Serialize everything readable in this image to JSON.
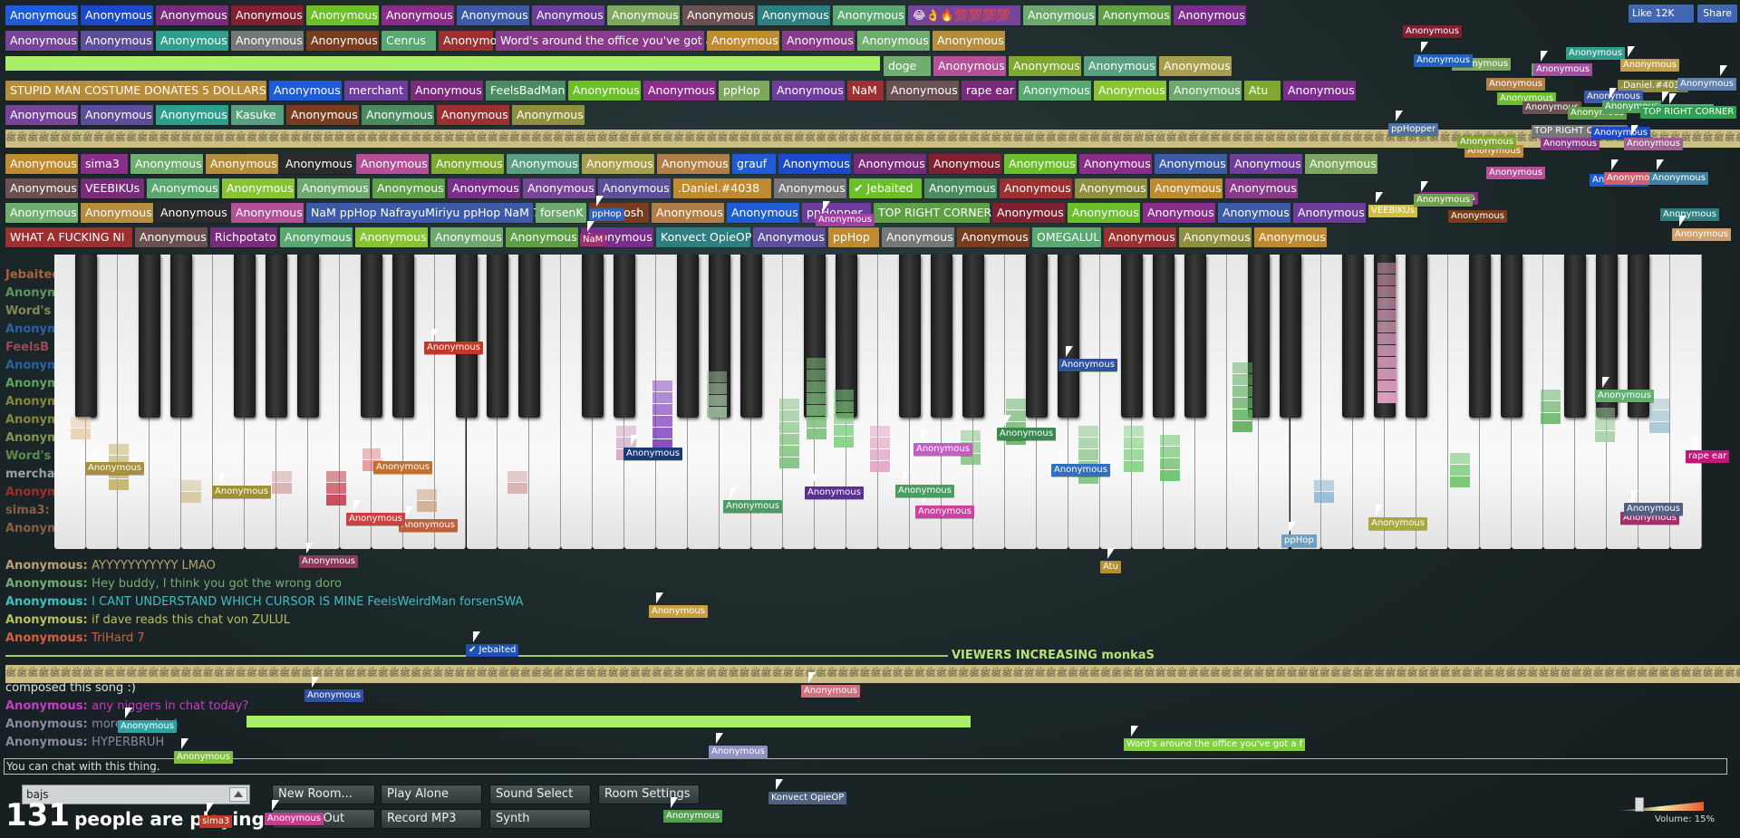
{
  "facebook": {
    "like": "Like 12K",
    "share": "Share"
  },
  "username_tags": [
    {
      "t": "Anonymous",
      "c": "#1f5bd6"
    },
    {
      "t": "Anonymous",
      "c": "#1a4acb"
    },
    {
      "t": "Anonymous",
      "c": "#7a2a7a"
    },
    {
      "t": "Anonymous",
      "c": "#802030"
    },
    {
      "t": "Anonymous",
      "c": "#6bbf2a"
    },
    {
      "t": "Anonymous",
      "c": "#8a2d8a"
    },
    {
      "t": "Anonymous",
      "c": "#3c5aa8"
    },
    {
      "t": "Anonymous",
      "c": "#6d3c9c"
    },
    {
      "t": "Anonymous",
      "c": "#7ea860"
    },
    {
      "t": "Anonymous",
      "c": "#6a5050"
    },
    {
      "t": "Anonymous",
      "c": "#2e7f7f"
    },
    {
      "t": "Anonymous",
      "c": "#58a870"
    },
    {
      "t": "Anonymous",
      "c": "#87c432"
    },
    {
      "t": "Anonymous",
      "c": "#6da86d"
    },
    {
      "t": "Anonymous",
      "c": "#5ea045"
    },
    {
      "t": "Anonymous",
      "c": "#7b2d8c"
    },
    {
      "t": "Anonymous",
      "c": "#76459a"
    },
    {
      "t": "Anonymous",
      "c": "#5c4e9b"
    },
    {
      "t": "Anonymous",
      "c": "#2f9f8c"
    },
    {
      "t": "Anonymous",
      "c": "#777777"
    },
    {
      "t": "Anonymous",
      "c": "#7a3c1e"
    },
    {
      "t": "Anonymous",
      "c": "#4a8c60"
    },
    {
      "t": "Anonymous",
      "c": "#9c2f2f"
    },
    {
      "t": "Anonymous",
      "c": "#8f8f40"
    },
    {
      "t": "Anonymous",
      "c": "#c08b30"
    },
    {
      "t": "Anonymous",
      "c": "#8a3a8a"
    },
    {
      "t": "Anonymous",
      "c": "#6fae6f"
    },
    {
      "t": "Anonymous",
      "c": "#b68d3c"
    },
    {
      "t": "Anonymous",
      "c": "#2b2b2b"
    },
    {
      "t": "Anonymous",
      "c": "#b44f98"
    },
    {
      "t": "Anonymous",
      "c": "#7ea830"
    },
    {
      "t": "Anonymous",
      "c": "#58a080"
    },
    {
      "t": "Anonymous",
      "c": "#a6a04e"
    },
    {
      "t": "Anonymous",
      "c": "#b37e46"
    }
  ],
  "row1_extra": [
    "Anonymous",
    "Anonymous",
    "Anonymous",
    "Anonymous",
    "Anonymous",
    "Anonymous",
    "Anonymous",
    "Anonymous",
    "Anonymous",
    "Anonymous",
    "Anonymous",
    "Anonymous",
    "Anonymous",
    "Anonymous"
  ],
  "named_tags": {
    "doge": "doge",
    "stupid": "STUPID MAN COSTUME DONATES 5 DOLLARS",
    "merchant": "merchant",
    "feelsbadman": "FeelsBadMan",
    "pphop": "ppHop",
    "nam": "NaM",
    "rape_ear": "rape ear",
    "atu": "Atu",
    "kasuke": "Kasuke",
    "sima3": "sima3",
    "grauf": "grauf",
    "veebikus": "VEEBIKUs",
    "daniel": ".Daniel.#4038",
    "jebaited": "✔ Jebaited",
    "nam_pphop": "NaM ppHop NafrayuMiriyu ppHop NaM 7",
    "forsenk": "forsenK",
    "teemosh": "Teemosh",
    "pphopper": "ppHopper",
    "top_right": "TOP RIGHT CORNER",
    "wtf": "WHAT A FUCKING NI",
    "richpotato": "Richpotato",
    "konvect": "Konvect OpieOP",
    "omegalul": "OMEGALUL",
    "words": "Word's around the office you've got a f",
    "cenrus": "Cenrus",
    "emotes": "😂👌🔥💯💯💯💯"
  },
  "chat": [
    {
      "name": "Anonymous:",
      "msg": "AYYYYYYYYYYY LMAO",
      "c": "#b8a070"
    },
    {
      "name": "Anonymous:",
      "msg": "Hey buddy, I think you got the wrong doro",
      "c": "#6fae6f"
    },
    {
      "name": "Anonymous:",
      "msg": "I CANT UNDERSTAND WHICH CURSOR IS MINE FeelsWeirdMan forsenSWA",
      "c": "#3fc0c0"
    },
    {
      "name": "Anonymous:",
      "msg": "if dave reads this chat von ZULUL",
      "c": "#b8c05a"
    },
    {
      "name": "Anonymous:",
      "msg": "TriHard 7",
      "c": "#d2603c"
    }
  ],
  "chat_lower": [
    {
      "name": "",
      "msg": "composed this song :)",
      "c": "#e0e0e0"
    },
    {
      "name": "Anonymous:",
      "msg": "any niggers in chat today?",
      "c": "#c040c0"
    },
    {
      "name": "Anonymous:",
      "msg": "more people :)",
      "c": "#8a8aa0"
    },
    {
      "name": "Anonymous:",
      "msg": "HYPERBRUH",
      "c": "#8a8aa0"
    }
  ],
  "viewers": "VIEWERS INCREASING monkaS",
  "chat_input": {
    "value": "You can chat with this thing."
  },
  "room": {
    "value": "bajs"
  },
  "buttons": {
    "new_room": "New Room...",
    "play_alone": "Play Alone",
    "sound_select": "Sound Select",
    "room_settings": "Room Settings",
    "midi": "MIDI In/Out",
    "record": "Record MP3",
    "synth": "Synth"
  },
  "players": {
    "count": "131",
    "text": "people are playing"
  },
  "volume": "Volume: 15%",
  "left_column": [
    "Jebaited",
    "Anonymous",
    "Word's",
    "Anonymous",
    "FeelsB",
    "Anonymous",
    "Anonymous",
    "Anonymous",
    "Anonymous",
    "Anonymous",
    "Word's",
    "merchant",
    "Anonymous",
    "sima3:",
    "Anonymous"
  ],
  "floating_names": [
    {
      "t": "Anonymous",
      "c": "#c0392b"
    },
    {
      "t": "Anonymous",
      "c": "#1a3a7a"
    },
    {
      "t": "Anonymous",
      "c": "#c07030"
    },
    {
      "t": "Anonymous",
      "c": "#a09030"
    },
    {
      "t": "Anonymous",
      "c": "#a8903c"
    },
    {
      "t": "Anonymous",
      "c": "#c0603a"
    },
    {
      "t": "Anonymous",
      "c": "#d04040"
    },
    {
      "t": "Anonymous",
      "c": "#8a3a5a"
    },
    {
      "t": "Anonymous",
      "c": "#3050a0"
    },
    {
      "t": "Anonymous",
      "c": "#4a9c60"
    },
    {
      "t": "Anonymous",
      "c": "#5a3090"
    },
    {
      "t": "Anonymous",
      "c": "#c060c0"
    },
    {
      "t": "Anonymous",
      "c": "#3a8a50"
    },
    {
      "t": "Anonymous",
      "c": "#d040a0"
    },
    {
      "t": "Anonymous",
      "c": "#4a9c60"
    },
    {
      "t": "Anonymous",
      "c": "#3070c0"
    },
    {
      "t": "Anonymous",
      "c": "#a8a840"
    },
    {
      "t": "Anonymous",
      "c": "#a03070"
    },
    {
      "t": "Anonymous",
      "c": "#506080"
    },
    {
      "t": "Atu",
      "c": "#b09030"
    },
    {
      "t": "Anonymous",
      "c": "#c8a040"
    },
    {
      "t": "✔ Jebaited",
      "c": "#2050b0"
    },
    {
      "t": "Anonymous",
      "c": "#3050a0"
    },
    {
      "t": "Anonymous",
      "c": "#d07080"
    },
    {
      "t": "Anonymous",
      "c": "#30a0a0"
    },
    {
      "t": "Anonymous",
      "c": "#9090c0"
    },
    {
      "t": "Anonymous",
      "c": "#80c040"
    },
    {
      "t": "Word's around the office you've got a f",
      "c": "#80d040"
    },
    {
      "t": "Konvect OpieOP",
      "c": "#506080"
    },
    {
      "t": "Anonymous",
      "c": "#50a050"
    },
    {
      "t": "Anonymous",
      "c": "#c04090"
    },
    {
      "t": "sima3",
      "c": "#c0392b"
    },
    {
      "t": "rape ear",
      "c": "#c0187a"
    },
    {
      "t": "ppHop",
      "c": "#70a0c0"
    },
    {
      "t": "Anonymous",
      "c": "#2060c0"
    },
    {
      "t": "Anonymous",
      "c": "#50a060"
    },
    {
      "t": "Anonymous",
      "c": "#50b080"
    },
    {
      "t": "TOP RIGHT CORNER",
      "c": "#30a050"
    },
    {
      "t": "Anonymous",
      "c": "#d0a070"
    },
    {
      "t": "Anonymous",
      "c": "#6080b0"
    },
    {
      "t": "Anonymous",
      "c": "#a06090"
    },
    {
      "t": "Anonymous",
      "c": "#c0a050"
    },
    {
      "t": "VEEBIKUs",
      "c": "#d0c040"
    },
    {
      "t": "Anonymous",
      "c": "#a040a0"
    },
    {
      "t": "ppHop",
      "c": "#3060c0"
    },
    {
      "t": "NaM",
      "c": "#a03070"
    },
    {
      "t": "ppHopper",
      "c": "#5070a0"
    },
    {
      "t": "Anonymous",
      "c": "#a050a0"
    },
    {
      "t": "Anonymous",
      "c": "#70a050"
    },
    {
      "t": "Anonymous",
      "c": "#d06070"
    },
    {
      "t": "Anonymous",
      "c": "#4080a0"
    },
    {
      "t": "Anonymous",
      "c": "#60b070"
    }
  ]
}
